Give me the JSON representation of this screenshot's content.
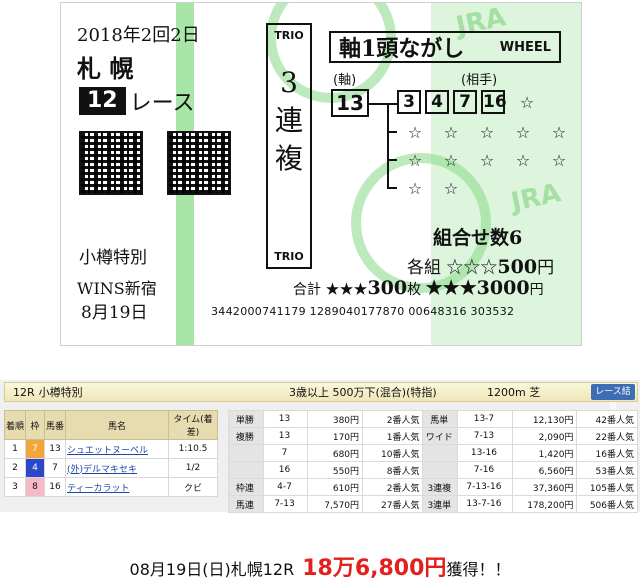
{
  "ticket": {
    "date": "2018年2回2日",
    "venue": "札 幌",
    "race_number": "12",
    "race_label": "レース",
    "race_name": "小樽特別",
    "shop": "WINS新宿",
    "shop_date": "8月19日",
    "bet_label_top": "TRIO",
    "bet_label_bottom": "TRIO",
    "bet_chars": [
      "3",
      "連",
      "複"
    ],
    "wheel_label": "軸1頭ながし",
    "wheel_label_en": "WHEEL",
    "axis_label": "(軸)",
    "partner_label": "(相手)",
    "axis_horse": "13",
    "partners": [
      "3",
      "4",
      "7",
      "16"
    ],
    "star": "☆",
    "combination": "組合せ数6",
    "each_prefix": "各組 ☆☆☆",
    "each_amount": "500",
    "each_unit": "円",
    "total_prefix": "合計 ★★★",
    "total_count": "300",
    "total_count_unit": "枚",
    "total_amount": "★★★3000",
    "total_unit": "円",
    "serial": "3442000741179 1289040177870 00648316 303532",
    "watermark": "JRA",
    "colors": {
      "green": "#a8e6a8",
      "watermark": "#7fd27f"
    }
  },
  "result": {
    "race": "12R",
    "name": "小樽特別",
    "conditions": "3歳以上 500万下(混合)(特指)",
    "distance": "1200m 芝",
    "button": "レース結果",
    "order_headers": [
      "着順",
      "枠",
      "馬番",
      "馬名",
      "タイム(着差)"
    ],
    "order_rows": [
      {
        "pos": "1",
        "frame": "7",
        "num": "13",
        "name": "シュエットヌーベル",
        "time": "1:10.5"
      },
      {
        "pos": "2",
        "frame": "4",
        "num": "7",
        "name": "(外)デルマキセキ",
        "time": "1/2"
      },
      {
        "pos": "3",
        "frame": "8",
        "num": "16",
        "name": "ティーカラット",
        "time": "クビ"
      }
    ],
    "payout_rows": [
      [
        "単勝",
        "13",
        "380円",
        "2番人気",
        "馬単",
        "13-7",
        "12,130円",
        "42番人気"
      ],
      [
        "複勝",
        "13",
        "170円",
        "1番人気",
        "ワイド",
        "7-13",
        "2,090円",
        "22番人気"
      ],
      [
        "",
        "7",
        "680円",
        "10番人気",
        "",
        "13-16",
        "1,420円",
        "16番人気"
      ],
      [
        "",
        "16",
        "550円",
        "8番人気",
        "",
        "7-16",
        "6,560円",
        "53番人気"
      ],
      [
        "枠連",
        "4-7",
        "610円",
        "2番人気",
        "3連複",
        "7-13-16",
        "37,360円",
        "105番人気"
      ],
      [
        "馬連",
        "7-13",
        "7,570円",
        "27番人気",
        "3連単",
        "13-7-16",
        "178,200円",
        "506番人気"
      ]
    ]
  },
  "caption": {
    "text": "08月19日(日)札幌12R",
    "amount": "18万6,800円",
    "suffix": "獲得！！"
  }
}
